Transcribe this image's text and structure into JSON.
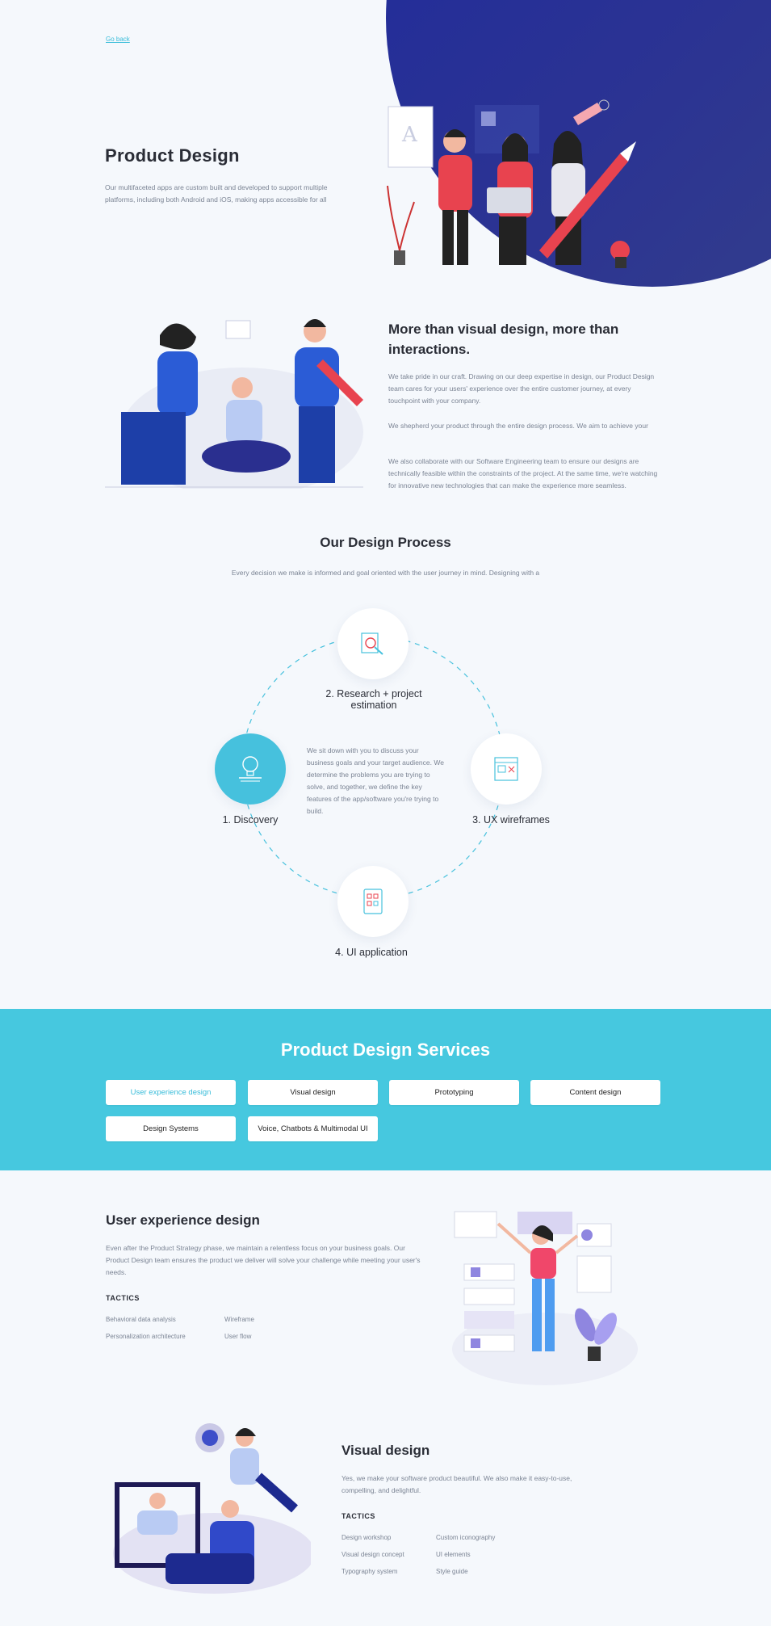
{
  "hero": {
    "go_back": "Go back",
    "title": "Product Design",
    "description": "Our multifaceted apps are custom built and developed to support multiple platforms, including both Android and iOS, making apps accessible for all"
  },
  "about": {
    "heading": "More than visual design, more than interactions.",
    "para1": "We take pride in our craft. Drawing on our deep expertise in design, our Product Design team cares for your users' experience over the entire customer journey, at every touchpoint with your company.",
    "para2": "We shepherd your product through the entire design process. We aim to achieve your",
    "para3": "We also collaborate with our Software Engineering team to ensure our designs are technically feasible within the constraints of the project. At the same time, we're watching for innovative new technologies that can make the experience more seamless."
  },
  "process": {
    "title": "Our Design Process",
    "subtitle": "Every decision we make is informed and goal oriented with the user journey in mind. Designing with a",
    "steps": [
      {
        "label": "1. Discovery",
        "icon": "lightbulb-icon"
      },
      {
        "label": "2. Research + project estimation",
        "icon": "research-magnifier-icon"
      },
      {
        "label": "3. UX wireframes",
        "icon": "wireframe-icon"
      },
      {
        "label": "4. UI application",
        "icon": "ui-application-icon"
      }
    ],
    "active_description": "We sit down with you to discuss your business goals and your target audience. We determine the problems you are trying to solve, and together, we define the key features of the app/software you're trying to build."
  },
  "services": {
    "title": "Product Design Services",
    "items": [
      "User experience design",
      "Visual design",
      "Prototyping",
      "Content design",
      "Design Systems",
      "Voice, Chatbots & Multimodal UI"
    ],
    "active_index": 0
  },
  "ux": {
    "heading": "User experience design",
    "description": "Even after the Product Strategy phase, we maintain a relentless focus on your business goals. Our Product Design team ensures the product we deliver will solve your challenge while meeting your user's needs.",
    "tactics_label": "TACTICS",
    "tactics": [
      "Behavioral data analysis",
      "Wireframe",
      "Personalization architecture",
      "User flow"
    ]
  },
  "visual": {
    "heading": "Visual design",
    "description": "Yes, we make your software product beautiful. We also make it easy-to-use, compelling, and delightful.",
    "tactics_label": "TACTICS",
    "tactics": [
      "Design workshop",
      "Custom iconography",
      "Visual design concept",
      "UI elements",
      "Typography system",
      "Style guide"
    ]
  },
  "colors": {
    "accent": "#46c8df",
    "hero_blue": "#2b3393",
    "red": "#e8434f"
  }
}
